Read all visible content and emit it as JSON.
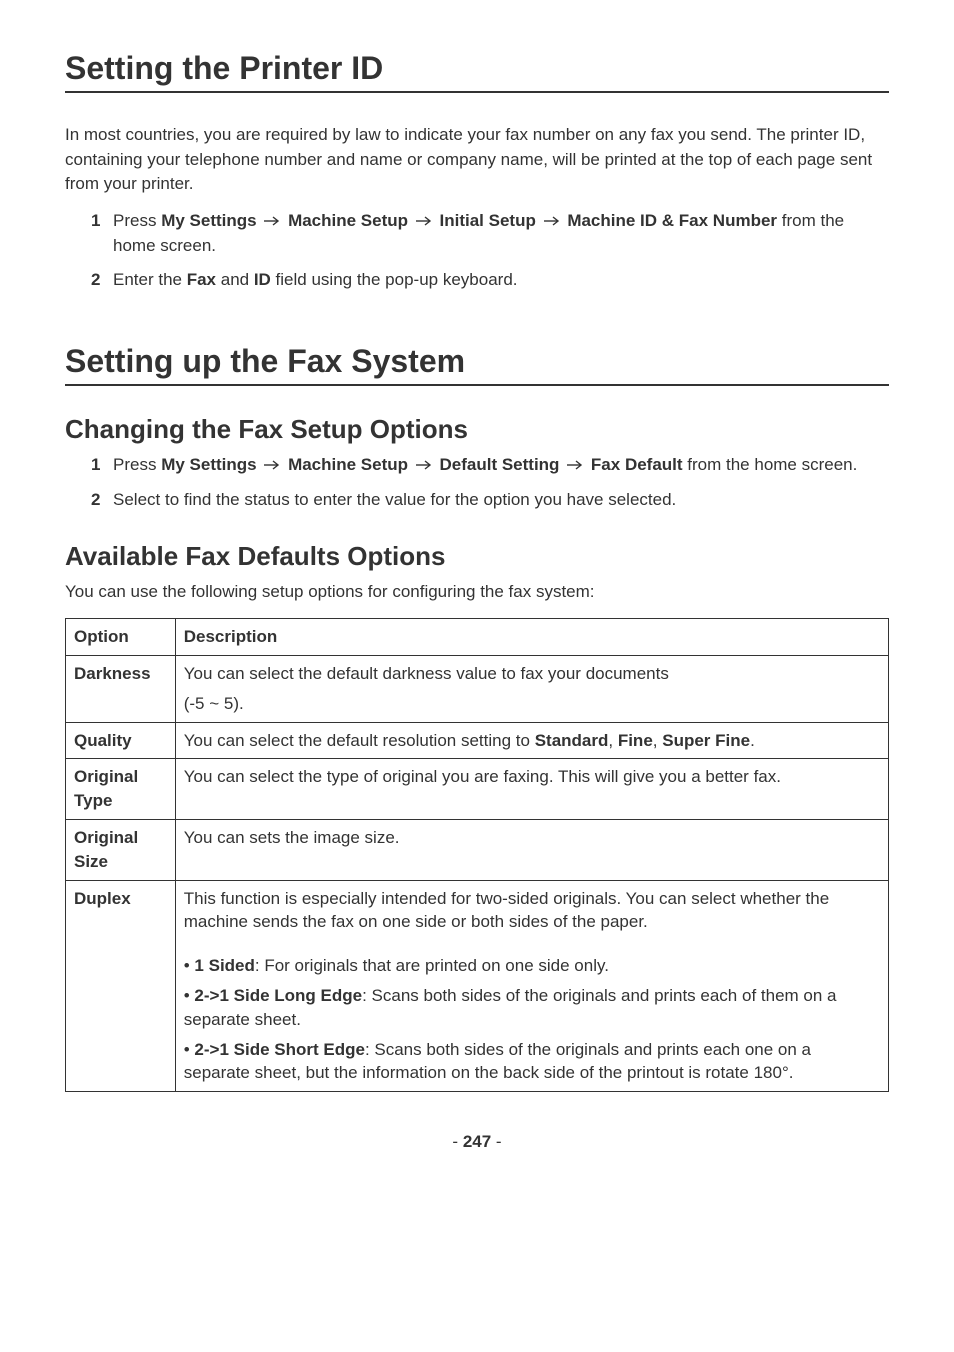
{
  "section1": {
    "title": "Setting the Printer ID",
    "intro": "In most countries, you are required by law to indicate your fax number on any fax you send. The printer ID, containing your telephone number and name or company name, will be printed at the top of each page sent from your printer.",
    "steps": {
      "s1": {
        "prefix": "Press ",
        "bold1": "My Settings",
        "bold2": "Machine Setup",
        "bold3": "Initial Setup",
        "bold4": "Machine ID & Fax Number",
        "suffix": " from the home screen."
      },
      "s2": {
        "prefix": "Enter the ",
        "bold1": "Fax",
        "mid": " and ",
        "bold2": "ID",
        "suffix": " field using the pop-up keyboard."
      }
    }
  },
  "section2": {
    "title": "Setting up the Fax System",
    "sub1": {
      "title": "Changing the Fax Setup Options",
      "steps": {
        "s1": {
          "prefix": "Press ",
          "bold1": "My Settings",
          "bold2": "Machine Setup",
          "bold3": "Default Setting",
          "bold4": "Fax Default",
          "suffix": " from the home screen."
        },
        "s2": {
          "text": "Select to find the status to enter the value for the option you have selected."
        }
      }
    },
    "sub2": {
      "title": "Available Fax Defaults Options",
      "intro": "You can use the following setup options for configuring the fax system:",
      "table": {
        "header": {
          "c1": "Option",
          "c2": "Description"
        },
        "rows": {
          "darkness": {
            "label": "Darkness",
            "p1": "You can select the default darkness value to fax your documents",
            "p2": "(-5 ~ 5)."
          },
          "quality": {
            "label": "Quality",
            "pre": "You can select the default resolution setting to ",
            "b1": "Standard",
            "sep1": ", ",
            "b2": "Fine",
            "sep2": ", ",
            "b3": "Super Fine",
            "post": "."
          },
          "originalType": {
            "label": "Original Type",
            "text": "You can select the type of original you are faxing. This will give you a better fax."
          },
          "originalSize": {
            "label": "Original Size",
            "text": "You can sets the image size."
          },
          "duplex": {
            "label": "Duplex",
            "intro": "This function is especially intended for two-sided originals. You can select whether the machine sends the fax on one side or both sides of the paper.",
            "item1": {
              "b": "1 Sided",
              "rest": ": For originals that are printed on one side only."
            },
            "item2": {
              "b": "2->1 Side Long Edge",
              "rest": ": Scans both sides of the originals and prints each of them on a separate sheet."
            },
            "item3": {
              "b": "2->1 Side Short Edge",
              "rest": ": Scans both sides of the originals and prints each one on a separate sheet, but the information on the back side of the printout is rotate 180°."
            }
          }
        }
      }
    }
  },
  "footer": {
    "dash1": "- ",
    "page": "247",
    "dash2": " -"
  },
  "glyphs": {
    "bullet": "• "
  }
}
